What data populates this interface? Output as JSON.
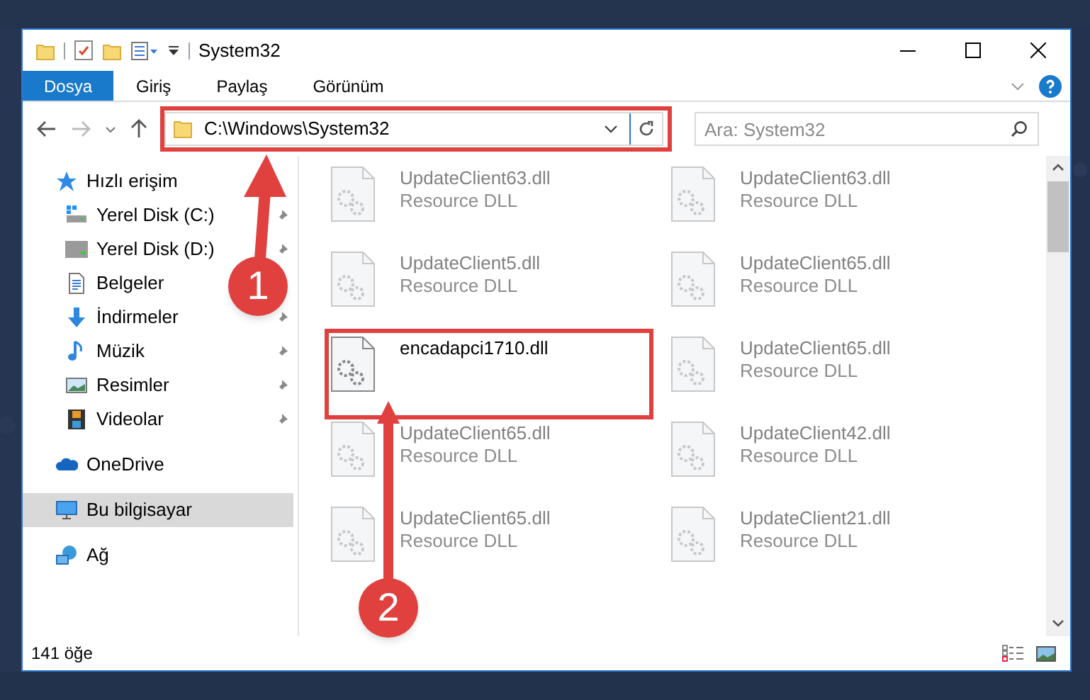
{
  "window": {
    "title": "System32"
  },
  "ribbon_tabs": [
    {
      "label": "Dosya",
      "selected": true
    },
    {
      "label": "Giriş",
      "selected": false
    },
    {
      "label": "Paylaş",
      "selected": false
    },
    {
      "label": "Görünüm",
      "selected": false
    }
  ],
  "address": {
    "path": "C:\\Windows\\System32"
  },
  "search": {
    "placeholder": "Ara: System32"
  },
  "sidebar": {
    "items": [
      {
        "label": "Hızlı erişim",
        "kind": "star",
        "selected": false,
        "children": [
          {
            "label": "Yerel Disk (C:)",
            "kind": "system-drive",
            "selected": false,
            "pinned": true
          },
          {
            "label": "Yerel Disk (D:)",
            "kind": "drive",
            "selected": false,
            "pinned": true
          },
          {
            "label": "Belgeler",
            "kind": "document",
            "selected": false,
            "pinned": false
          },
          {
            "label": "İndirmeler",
            "kind": "download",
            "selected": false,
            "pinned": true
          },
          {
            "label": "Müzik",
            "kind": "music",
            "selected": false,
            "pinned": true
          },
          {
            "label": "Resimler",
            "kind": "pictures",
            "selected": false,
            "pinned": true
          },
          {
            "label": "Videolar",
            "kind": "videos",
            "selected": false,
            "pinned": true
          }
        ]
      },
      {
        "label": "OneDrive",
        "kind": "cloud",
        "selected": false
      },
      {
        "label": "Bu bilgisayar",
        "kind": "computer",
        "selected": true
      },
      {
        "label": "Ağ",
        "kind": "network",
        "selected": false
      }
    ]
  },
  "files": [
    {
      "name": "UpdateClient63.dll",
      "type": "Resource DLL",
      "dimmed": true
    },
    {
      "name": "UpdateClient63.dll",
      "type": "Resource DLL",
      "dimmed": true
    },
    {
      "name": "UpdateClient5.dll",
      "type": "Resource DLL",
      "dimmed": true
    },
    {
      "name": "UpdateClient65.dll",
      "type": "Resource DLL",
      "dimmed": true
    },
    {
      "name": "encadapci1710.dll",
      "dimmed": false
    },
    {
      "name": "UpdateClient65.dll",
      "type": "Resource DLL",
      "dimmed": true
    },
    {
      "name": "UpdateClient65.dll",
      "type": "Resource DLL",
      "dimmed": true
    },
    {
      "name": "UpdateClient42.dll",
      "type": "Resource DLL",
      "dimmed": true
    },
    {
      "name": "UpdateClient65.dll",
      "type": "Resource DLL",
      "dimmed": true
    },
    {
      "name": "UpdateClient21.dll",
      "type": "Resource DLL",
      "dimmed": true
    }
  ],
  "status_bar": {
    "item_count": "141 öğe"
  },
  "annotations": [
    {
      "label": "1"
    },
    {
      "label": "2"
    }
  ]
}
